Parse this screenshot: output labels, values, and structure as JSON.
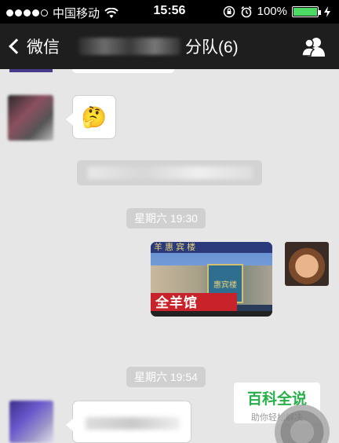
{
  "status_bar": {
    "carrier": "中国移动",
    "time": "15:56",
    "battery_percent": "100%",
    "battery_level": 1.0,
    "icons": [
      "signal-icon",
      "wifi-icon",
      "rotation-lock-icon",
      "alarm-icon",
      "battery-icon",
      "charging-icon"
    ]
  },
  "nav": {
    "back_label": "微信",
    "title_suffix": "分队(6)",
    "contacts_icon": "group-contacts-icon"
  },
  "messages": {
    "emoji": "🤔",
    "time_1": "星期六 19:30",
    "time_2": "星期六 19:54",
    "image_text_band": "全羊馆",
    "image_text_sign": "惠宾楼",
    "image_text_banner": "羊 惠 宾 楼"
  },
  "watermark": {
    "title": "百科全说",
    "subtitle": "助你轻松解决"
  },
  "colors": {
    "nav_bg": "#1e1e1e",
    "chat_bg": "#e6e6e6",
    "time_chip": "#d0d0d0",
    "watermark_green": "#27b04a"
  }
}
